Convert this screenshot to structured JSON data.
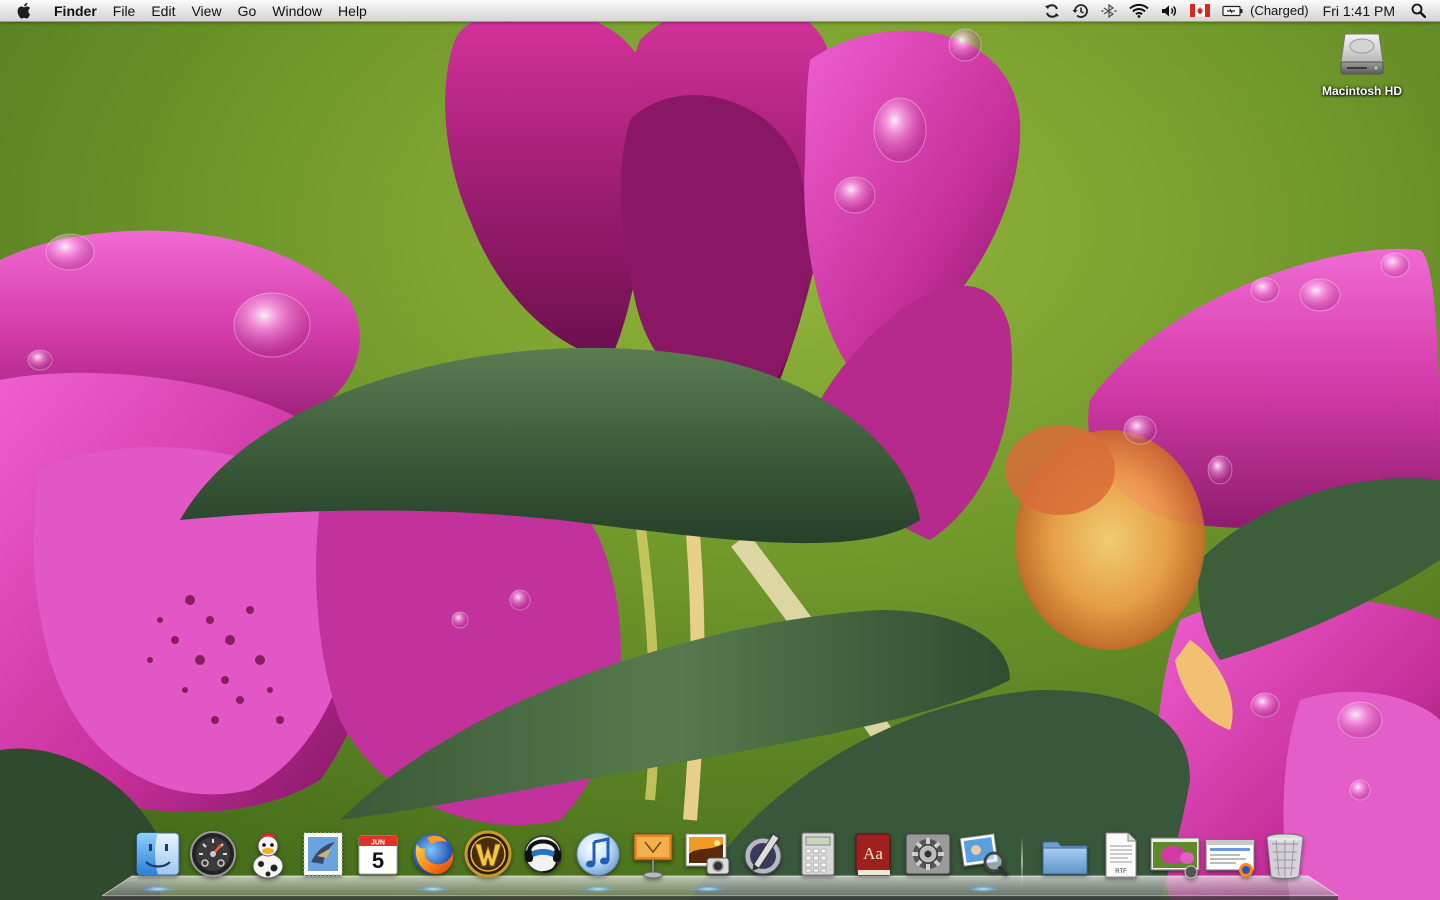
{
  "menubar": {
    "app_name": "Finder",
    "menus": [
      "File",
      "Edit",
      "View",
      "Go",
      "Window",
      "Help"
    ],
    "status_icons": [
      "sync-icon",
      "time-machine-icon",
      "bluetooth-icon",
      "wifi-icon",
      "volume-icon",
      "canada-flag-icon",
      "battery-icon"
    ],
    "battery_status": "(Charged)",
    "clock": "Fri 1:41 PM"
  },
  "desktop": {
    "icons": [
      {
        "label": "Macintosh HD",
        "icon": "hard-drive-icon"
      }
    ]
  },
  "dock": {
    "apps": [
      {
        "name": "finder",
        "icon": "finder-icon",
        "running": true
      },
      {
        "name": "dashboard",
        "icon": "dashboard-icon",
        "running": false
      },
      {
        "name": "adium",
        "icon": "adium-duck-icon",
        "running": false
      },
      {
        "name": "mail",
        "icon": "mail-stamp-icon",
        "running": false
      },
      {
        "name": "ical",
        "icon": "calendar-icon",
        "running": false,
        "month": "JUN",
        "day": "5"
      },
      {
        "name": "firefox",
        "icon": "firefox-icon",
        "running": true
      },
      {
        "name": "world-of-warcraft",
        "icon": "wow-icon",
        "running": false
      },
      {
        "name": "audio-app",
        "icon": "headset-icon",
        "running": false
      },
      {
        "name": "itunes",
        "icon": "itunes-icon",
        "running": true
      },
      {
        "name": "keynote",
        "icon": "keynote-icon",
        "running": false
      },
      {
        "name": "iphoto",
        "icon": "iphoto-icon",
        "running": true
      },
      {
        "name": "script-editor",
        "icon": "pen-icon",
        "running": false
      },
      {
        "name": "calculator",
        "icon": "calculator-icon",
        "running": false
      },
      {
        "name": "dictionary",
        "icon": "dictionary-icon",
        "running": false,
        "glyph": "Aa"
      },
      {
        "name": "system-preferences",
        "icon": "gear-icon",
        "running": false
      },
      {
        "name": "preview",
        "icon": "preview-icon",
        "running": true
      }
    ],
    "stacks": [
      {
        "name": "applications-folder",
        "icon": "folder-icon"
      },
      {
        "name": "rtf-document",
        "icon": "document-icon",
        "tag": "RTF"
      },
      {
        "name": "minimized-photo",
        "icon": "photo-window-icon"
      },
      {
        "name": "minimized-firefox",
        "icon": "browser-window-icon"
      },
      {
        "name": "trash",
        "icon": "trash-icon"
      }
    ]
  }
}
